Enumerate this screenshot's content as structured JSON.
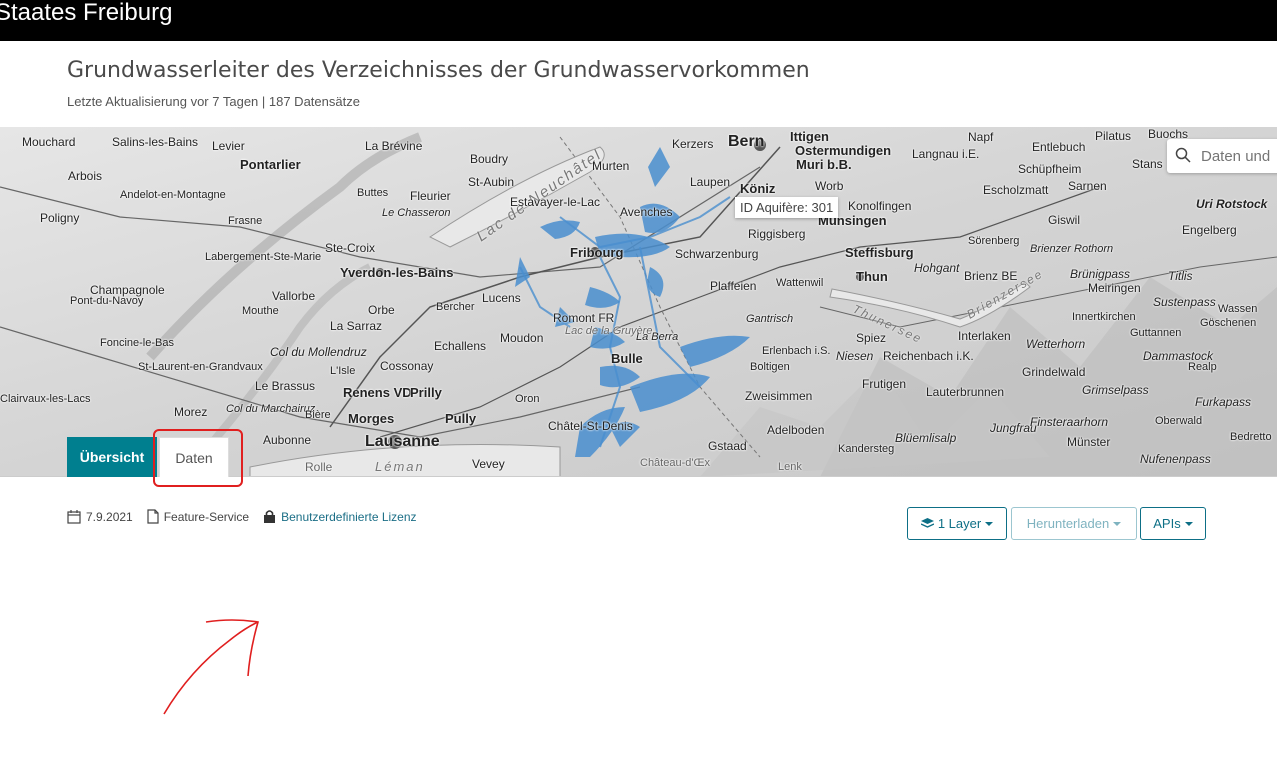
{
  "header": {
    "title": "Staates Freiburg"
  },
  "page": {
    "title": "Grundwasserleiter des Verzeichnisses der Grundwasservorkommen",
    "subtitle": "Letzte Aktualisierung vor 7 Tagen | 187 Datensätze"
  },
  "map": {
    "tooltip": "ID Aquifère: 301",
    "search_placeholder": "Daten und",
    "places": [
      "Mouchard",
      "Salins-les-Bains",
      "Levier",
      "Pontarlier",
      "La Brévine",
      "Boudry",
      "Lac de Neuchâtel",
      "Murten",
      "Kerzers",
      "Bern",
      "Ittigen",
      "Ostermundigen",
      "Muri b.B.",
      "Napf",
      "Pilatus",
      "Buochs",
      "Langnau i.E.",
      "Entlebuch",
      "Schüpfheim",
      "Stans",
      "Arbois",
      "Andelot-en-Montagne",
      "Fleurier",
      "St-Aubin",
      "Estavayer-le-Lac",
      "Avenches",
      "Laupen",
      "Köniz",
      "Worb",
      "Escholzmatt",
      "Sarnen",
      "Poligny",
      "Frasne",
      "Buttes",
      "Le Chasseron",
      "Konolfingen",
      "Münsingen",
      "Giswil",
      "Uri Rotstock",
      "Engelberg",
      "Ste-Croix",
      "Fribourg",
      "Schwarzenburg",
      "Riggisberg",
      "Steffisburg",
      "Sörenberg",
      "Brienzer Rothorn",
      "Labergement-Ste-Marie",
      "Yverdon-les-Bains",
      "Thun",
      "Hohgant",
      "Brienz BE",
      "Brünigpass",
      "Titlis",
      "Champagnole",
      "Vallorbe",
      "Lucens",
      "Plaffeien",
      "Wattenwil",
      "Meiringen",
      "Sustenpass",
      "Pont-du-Navoy",
      "Orbe",
      "Bercher",
      "Romont FR",
      "Gantrisch",
      "Thunersee",
      "Brienzersee",
      "Innertkirchen",
      "Wassen",
      "Göschenen",
      "Mouthe",
      "La Sarraz",
      "Moudon",
      "Lac de la Gruyère",
      "La Berra",
      "Spiez",
      "Interlaken",
      "Guttannen",
      "Foncine-le-Bas",
      "Col du Mollendruz",
      "Echallens",
      "Bulle",
      "Erlenbach i.S.",
      "Niesen",
      "Reichenbach i.K.",
      "Wetterhorn",
      "Dammastock",
      "St-Laurent-en-Grandvaux",
      "L'Isle",
      "Cossonay",
      "Boltigen",
      "Frutigen",
      "Lauterbrunnen",
      "Grindelwald",
      "Realp",
      "Le Brassus",
      "Renens VD",
      "Prilly",
      "Zweisimmen",
      "Grimselpass",
      "Clairvaux-les-Lacs",
      "Morez",
      "Col du Marchairuz",
      "Bière",
      "Morges",
      "Pully",
      "Oron",
      "Châtel-St-Denis",
      "Jungfrau",
      "Finsteraarhorn",
      "Furkapass",
      "Aubonne",
      "Lausanne",
      "Vevey",
      "Gstaad",
      "Adelboden",
      "Blüemlisalp",
      "Kandersteg",
      "Oberwald",
      "Münster",
      "Bedretto",
      "Nufenenpass",
      "Rolle",
      "Léman",
      "Lenk",
      "Château-d'Œx"
    ]
  },
  "tabs": {
    "overview": "Übersicht",
    "data": "Daten"
  },
  "meta": {
    "date": "7.9.2021",
    "type": "Feature-Service",
    "license": "Benutzerdefinierte Lizenz"
  },
  "buttons": {
    "layers": "1 Layer",
    "download": "Herunterladen",
    "apis": "APIs"
  },
  "colors": {
    "accent": "#007f8f",
    "link": "#1b6e86",
    "highlight": "#e01f1f",
    "aquifer": "#4a8fcf"
  }
}
